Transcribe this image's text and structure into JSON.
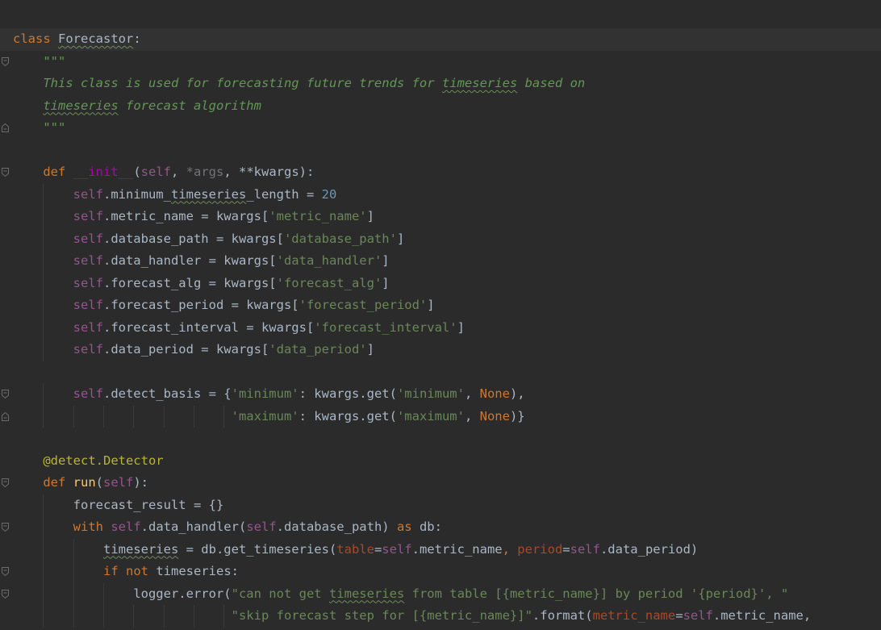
{
  "colors": {
    "background": "#2b2b2b",
    "caret_line": "#323232",
    "keyword": "#cc7832",
    "self": "#94558d",
    "string": "#6a8759",
    "number": "#6897bb",
    "docstring": "#629755",
    "decorator": "#bbb529",
    "function": "#ffc66d",
    "identifier": "#a9b7c6"
  },
  "editor": {
    "language": "python",
    "lines": [
      {
        "fold": "start",
        "tokens": [
          {
            "t": "class",
            "c": "kw"
          },
          {
            "t": " "
          },
          {
            "t": "Forecastor",
            "typo": true
          },
          {
            "t": ":"
          }
        ]
      },
      {
        "fold": "start",
        "tokens": [
          {
            "t": "    "
          },
          {
            "t": "\"\"\"",
            "c": "doc"
          }
        ]
      },
      {
        "tokens": [
          {
            "t": "    "
          },
          {
            "t": "This class is used for forecasting future trends for ",
            "c": "doc"
          },
          {
            "t": "timeseries",
            "c": "doc",
            "typo": true
          },
          {
            "t": " based on",
            "c": "doc"
          }
        ]
      },
      {
        "tokens": [
          {
            "t": "    "
          },
          {
            "t": "timeseries",
            "c": "doc",
            "typo": true
          },
          {
            "t": " forecast algorithm",
            "c": "doc"
          }
        ]
      },
      {
        "fold": "end",
        "tokens": [
          {
            "t": "    "
          },
          {
            "t": "\"\"\"",
            "c": "doc"
          }
        ]
      },
      {
        "tokens": []
      },
      {
        "fold": "start",
        "tokens": [
          {
            "t": "    "
          },
          {
            "t": "def",
            "c": "kw"
          },
          {
            "t": " "
          },
          {
            "t": "__init__",
            "c": "magic"
          },
          {
            "t": "("
          },
          {
            "t": "self",
            "c": "self"
          },
          {
            "t": ", "
          },
          {
            "t": "*args",
            "c": "dim"
          },
          {
            "t": ", "
          },
          {
            "t": "**kwargs"
          },
          {
            "t": "):"
          }
        ]
      },
      {
        "tokens": [
          {
            "t": "        "
          },
          {
            "t": "self",
            "c": "self"
          },
          {
            "t": ".minimum_"
          },
          {
            "t": "timeseries",
            "typo": true
          },
          {
            "t": "_length = "
          },
          {
            "t": "20",
            "c": "num"
          }
        ]
      },
      {
        "tokens": [
          {
            "t": "        "
          },
          {
            "t": "self",
            "c": "self"
          },
          {
            "t": ".metric_name = kwargs["
          },
          {
            "t": "'metric_name'",
            "c": "str"
          },
          {
            "t": "]"
          }
        ]
      },
      {
        "tokens": [
          {
            "t": "        "
          },
          {
            "t": "self",
            "c": "self"
          },
          {
            "t": ".database_path = kwargs["
          },
          {
            "t": "'database_path'",
            "c": "str"
          },
          {
            "t": "]"
          }
        ]
      },
      {
        "tokens": [
          {
            "t": "        "
          },
          {
            "t": "self",
            "c": "self"
          },
          {
            "t": ".data_handler = kwargs["
          },
          {
            "t": "'data_handler'",
            "c": "str"
          },
          {
            "t": "]"
          }
        ]
      },
      {
        "tokens": [
          {
            "t": "        "
          },
          {
            "t": "self",
            "c": "self"
          },
          {
            "t": ".forecast_alg = kwargs["
          },
          {
            "t": "'forecast_alg'",
            "c": "str"
          },
          {
            "t": "]"
          }
        ]
      },
      {
        "tokens": [
          {
            "t": "        "
          },
          {
            "t": "self",
            "c": "self"
          },
          {
            "t": ".forecast_period = kwargs["
          },
          {
            "t": "'forecast_period'",
            "c": "str"
          },
          {
            "t": "]"
          }
        ]
      },
      {
        "tokens": [
          {
            "t": "        "
          },
          {
            "t": "self",
            "c": "self"
          },
          {
            "t": ".forecast_interval = kwargs["
          },
          {
            "t": "'forecast_interval'",
            "c": "str"
          },
          {
            "t": "]"
          }
        ]
      },
      {
        "tokens": [
          {
            "t": "        "
          },
          {
            "t": "self",
            "c": "self"
          },
          {
            "t": ".data_period = kwargs["
          },
          {
            "t": "'data_period'",
            "c": "str"
          },
          {
            "t": "]"
          }
        ]
      },
      {
        "tokens": []
      },
      {
        "fold": "start",
        "tokens": [
          {
            "t": "        "
          },
          {
            "t": "self",
            "c": "self"
          },
          {
            "t": ".detect_basis = {"
          },
          {
            "t": "'minimum'",
            "c": "str"
          },
          {
            "t": ": kwargs.get("
          },
          {
            "t": "'minimum'",
            "c": "str"
          },
          {
            "t": ", "
          },
          {
            "t": "None",
            "c": "kw"
          },
          {
            "t": "),"
          }
        ]
      },
      {
        "fold": "end",
        "tokens": [
          {
            "t": "                             "
          },
          {
            "t": "'maximum'",
            "c": "str"
          },
          {
            "t": ": kwargs.get("
          },
          {
            "t": "'maximum'",
            "c": "str"
          },
          {
            "t": ", "
          },
          {
            "t": "None",
            "c": "kw"
          },
          {
            "t": ")}"
          }
        ]
      },
      {
        "tokens": []
      },
      {
        "tokens": [
          {
            "t": "    "
          },
          {
            "t": "@detect.Detector",
            "c": "dec"
          }
        ]
      },
      {
        "fold": "start",
        "tokens": [
          {
            "t": "    "
          },
          {
            "t": "def",
            "c": "kw"
          },
          {
            "t": " "
          },
          {
            "t": "run",
            "c": "fn"
          },
          {
            "t": "("
          },
          {
            "t": "self",
            "c": "self"
          },
          {
            "t": "):"
          }
        ]
      },
      {
        "tokens": [
          {
            "t": "        "
          },
          {
            "t": "forecast_result = {}"
          }
        ]
      },
      {
        "fold": "start",
        "tokens": [
          {
            "t": "        "
          },
          {
            "t": "with",
            "c": "kw"
          },
          {
            "t": " "
          },
          {
            "t": "self",
            "c": "self"
          },
          {
            "t": ".data_handler("
          },
          {
            "t": "self",
            "c": "self"
          },
          {
            "t": ".database_path) "
          },
          {
            "t": "as",
            "c": "kw"
          },
          {
            "t": " db:"
          }
        ]
      },
      {
        "tokens": [
          {
            "t": "            "
          },
          {
            "t": "timeseries",
            "typo": true
          },
          {
            "t": " = db.get_timeseries("
          },
          {
            "t": "table",
            "c": "param"
          },
          {
            "t": "="
          },
          {
            "t": "self",
            "c": "self"
          },
          {
            "t": ".metric_name"
          },
          {
            "t": ", ",
            "c": "kw"
          },
          {
            "t": "period",
            "c": "param"
          },
          {
            "t": "="
          },
          {
            "t": "self",
            "c": "self"
          },
          {
            "t": ".data_period)"
          }
        ]
      },
      {
        "fold": "start",
        "tokens": [
          {
            "t": "            "
          },
          {
            "t": "if",
            "c": "kw"
          },
          {
            "t": " "
          },
          {
            "t": "not",
            "c": "kw"
          },
          {
            "t": " timeseries:"
          }
        ]
      },
      {
        "fold": "start",
        "tokens": [
          {
            "t": "                "
          },
          {
            "t": "logger.error("
          },
          {
            "t": "\"can not get ",
            "c": "str"
          },
          {
            "t": "timeseries",
            "c": "str",
            "typo": true
          },
          {
            "t": " from table [{metric_name}] by period '{period}', \"",
            "c": "str"
          }
        ]
      },
      {
        "tokens": [
          {
            "t": "                             "
          },
          {
            "t": "\"skip forecast step for [{metric_name}]\"",
            "c": "str"
          },
          {
            "t": ".format("
          },
          {
            "t": "metric_name",
            "c": "param"
          },
          {
            "t": "="
          },
          {
            "t": "self",
            "c": "self"
          },
          {
            "t": ".metric_name,"
          }
        ]
      }
    ]
  }
}
